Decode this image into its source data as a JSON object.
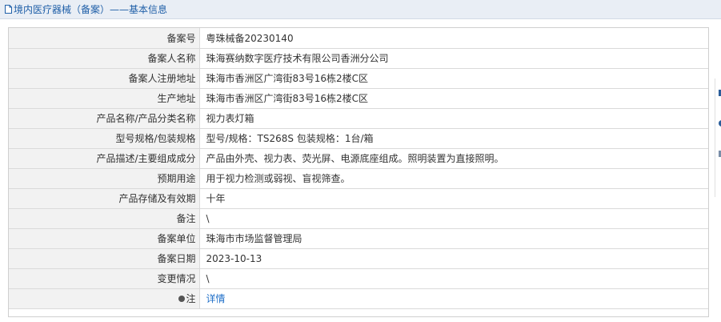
{
  "header": {
    "title": "境内医疗器械（备案）——基本信息",
    "icon": "document-icon",
    "accent_color": "#1f5fa8"
  },
  "rows": [
    {
      "label": "备案号",
      "value": "粤珠械备20230140"
    },
    {
      "label": "备案人名称",
      "value": "珠海赛纳数字医疗技术有限公司香洲分公司"
    },
    {
      "label": "备案人注册地址",
      "value": "珠海市香洲区广湾街83号16栋2楼C区"
    },
    {
      "label": "生产地址",
      "value": "珠海市香洲区广湾街83号16栋2楼C区"
    },
    {
      "label": "产品名称/产品分类名称",
      "value": "视力表灯箱"
    },
    {
      "label": "型号规格/包装规格",
      "value": "型号/规格：TS268S 包装规格：1台/箱"
    },
    {
      "label": "产品描述/主要组成成分",
      "value": "产品由外壳、视力表、荧光屏、电源底座组成。照明装置为直接照明。"
    },
    {
      "label": "预期用途",
      "value": "用于视力检测或弱视、盲视筛查。"
    },
    {
      "label": "产品存储及有效期",
      "value": "十年"
    },
    {
      "label": "备注",
      "value": "\\"
    },
    {
      "label": "备案单位",
      "value": "珠海市市场监督管理局"
    },
    {
      "label": "备案日期",
      "value": "2023-10-13"
    },
    {
      "label": "变更情况",
      "value": "\\"
    }
  ],
  "note_row": {
    "label": "注",
    "icon": "pin-icon",
    "link_text": "详情",
    "link_color": "#1f6fc8"
  }
}
